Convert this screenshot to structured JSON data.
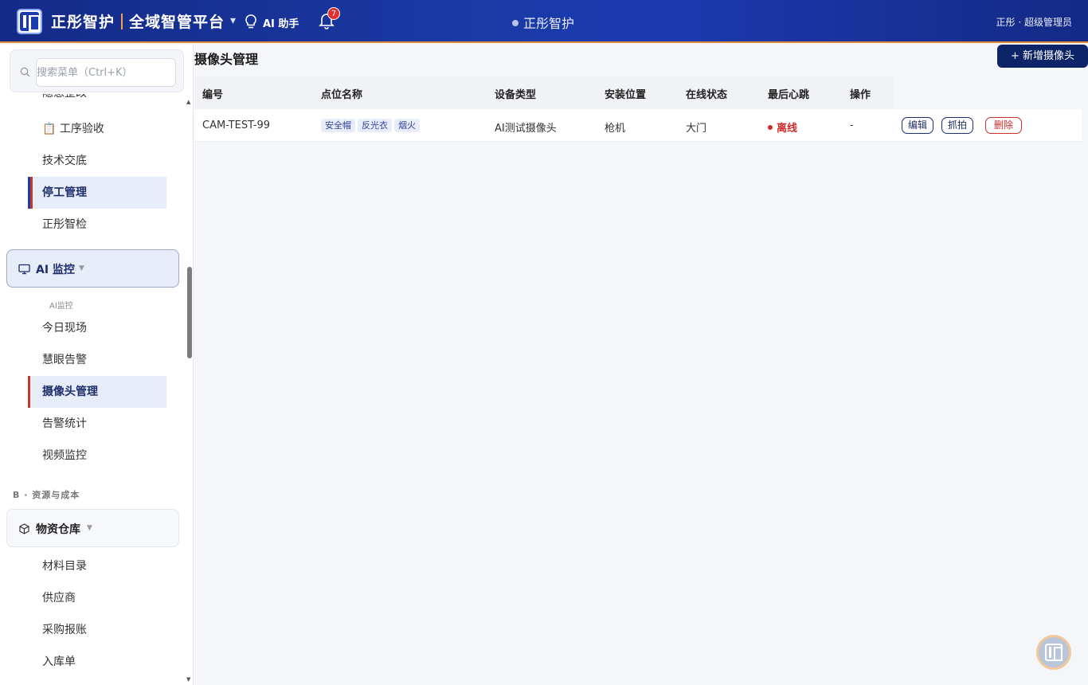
{
  "header": {
    "brand_name": "正彤智护",
    "platform_name": "全域智管平台",
    "ai_assistant_label": "AI 助手",
    "notification_count": "7",
    "center_title": "正彤智护",
    "user_label": "正彤 · 超级管理员"
  },
  "sidebar": {
    "search_placeholder": "搜索菜单（Ctrl+K）",
    "clipped_item": "隐患整改",
    "items_top": [
      {
        "label": "📋 工序验收"
      },
      {
        "label": "技术交底"
      },
      {
        "label": "停工管理"
      },
      {
        "label": "正彤智检"
      }
    ],
    "ai_group": {
      "label": "AI 监控",
      "caption": "AI监控"
    },
    "ai_items": [
      {
        "label": "今日现场"
      },
      {
        "label": "慧眼告警"
      },
      {
        "label": "摄像头管理"
      },
      {
        "label": "告警统计"
      },
      {
        "label": "视频监控"
      }
    ],
    "section_b": "B · 资源与成本",
    "warehouse_group": {
      "label": "物资仓库"
    },
    "warehouse_items": [
      {
        "label": "材料目录"
      },
      {
        "label": "供应商"
      },
      {
        "label": "采购报账"
      },
      {
        "label": "入库单"
      }
    ]
  },
  "main": {
    "title": "摄像头管理",
    "add_button": "+ 新增摄像头",
    "columns": [
      "编号",
      "点位名称",
      "设备类型",
      "安装位置",
      "在线状态",
      "最后心跳",
      "操作"
    ],
    "rows": [
      {
        "id": "CAM-TEST-99",
        "tags": [
          "安全帽",
          "反光衣",
          "烟火"
        ],
        "device_type": "AI测试摄像头",
        "location": "枪机",
        "position": "大门",
        "status": "离线",
        "heartbeat": "-",
        "actions": [
          "编辑",
          "抓拍",
          "删除"
        ]
      }
    ]
  },
  "colors": {
    "header_bg": "#1a3aa6",
    "accent": "#0e2468",
    "danger": "#d02c2c",
    "header_border": "#e28a3c"
  }
}
